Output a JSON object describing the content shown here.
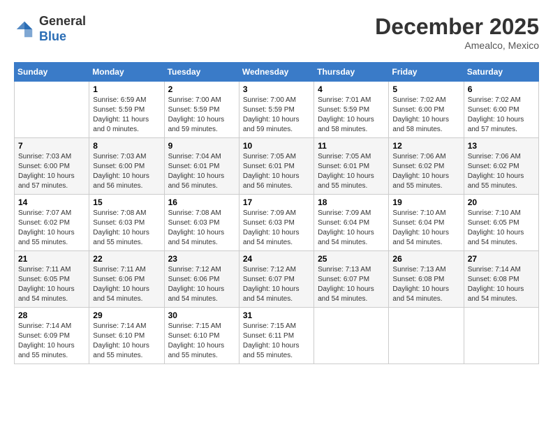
{
  "header": {
    "logo_general": "General",
    "logo_blue": "Blue",
    "month_year": "December 2025",
    "location": "Amealco, Mexico"
  },
  "columns": [
    "Sunday",
    "Monday",
    "Tuesday",
    "Wednesday",
    "Thursday",
    "Friday",
    "Saturday"
  ],
  "weeks": [
    [
      {
        "day": "",
        "info": ""
      },
      {
        "day": "1",
        "info": "Sunrise: 6:59 AM\nSunset: 5:59 PM\nDaylight: 11 hours\nand 0 minutes."
      },
      {
        "day": "2",
        "info": "Sunrise: 7:00 AM\nSunset: 5:59 PM\nDaylight: 10 hours\nand 59 minutes."
      },
      {
        "day": "3",
        "info": "Sunrise: 7:00 AM\nSunset: 5:59 PM\nDaylight: 10 hours\nand 59 minutes."
      },
      {
        "day": "4",
        "info": "Sunrise: 7:01 AM\nSunset: 5:59 PM\nDaylight: 10 hours\nand 58 minutes."
      },
      {
        "day": "5",
        "info": "Sunrise: 7:02 AM\nSunset: 6:00 PM\nDaylight: 10 hours\nand 58 minutes."
      },
      {
        "day": "6",
        "info": "Sunrise: 7:02 AM\nSunset: 6:00 PM\nDaylight: 10 hours\nand 57 minutes."
      }
    ],
    [
      {
        "day": "7",
        "info": "Sunrise: 7:03 AM\nSunset: 6:00 PM\nDaylight: 10 hours\nand 57 minutes."
      },
      {
        "day": "8",
        "info": "Sunrise: 7:03 AM\nSunset: 6:00 PM\nDaylight: 10 hours\nand 56 minutes."
      },
      {
        "day": "9",
        "info": "Sunrise: 7:04 AM\nSunset: 6:01 PM\nDaylight: 10 hours\nand 56 minutes."
      },
      {
        "day": "10",
        "info": "Sunrise: 7:05 AM\nSunset: 6:01 PM\nDaylight: 10 hours\nand 56 minutes."
      },
      {
        "day": "11",
        "info": "Sunrise: 7:05 AM\nSunset: 6:01 PM\nDaylight: 10 hours\nand 55 minutes."
      },
      {
        "day": "12",
        "info": "Sunrise: 7:06 AM\nSunset: 6:02 PM\nDaylight: 10 hours\nand 55 minutes."
      },
      {
        "day": "13",
        "info": "Sunrise: 7:06 AM\nSunset: 6:02 PM\nDaylight: 10 hours\nand 55 minutes."
      }
    ],
    [
      {
        "day": "14",
        "info": "Sunrise: 7:07 AM\nSunset: 6:02 PM\nDaylight: 10 hours\nand 55 minutes."
      },
      {
        "day": "15",
        "info": "Sunrise: 7:08 AM\nSunset: 6:03 PM\nDaylight: 10 hours\nand 55 minutes."
      },
      {
        "day": "16",
        "info": "Sunrise: 7:08 AM\nSunset: 6:03 PM\nDaylight: 10 hours\nand 54 minutes."
      },
      {
        "day": "17",
        "info": "Sunrise: 7:09 AM\nSunset: 6:03 PM\nDaylight: 10 hours\nand 54 minutes."
      },
      {
        "day": "18",
        "info": "Sunrise: 7:09 AM\nSunset: 6:04 PM\nDaylight: 10 hours\nand 54 minutes."
      },
      {
        "day": "19",
        "info": "Sunrise: 7:10 AM\nSunset: 6:04 PM\nDaylight: 10 hours\nand 54 minutes."
      },
      {
        "day": "20",
        "info": "Sunrise: 7:10 AM\nSunset: 6:05 PM\nDaylight: 10 hours\nand 54 minutes."
      }
    ],
    [
      {
        "day": "21",
        "info": "Sunrise: 7:11 AM\nSunset: 6:05 PM\nDaylight: 10 hours\nand 54 minutes."
      },
      {
        "day": "22",
        "info": "Sunrise: 7:11 AM\nSunset: 6:06 PM\nDaylight: 10 hours\nand 54 minutes."
      },
      {
        "day": "23",
        "info": "Sunrise: 7:12 AM\nSunset: 6:06 PM\nDaylight: 10 hours\nand 54 minutes."
      },
      {
        "day": "24",
        "info": "Sunrise: 7:12 AM\nSunset: 6:07 PM\nDaylight: 10 hours\nand 54 minutes."
      },
      {
        "day": "25",
        "info": "Sunrise: 7:13 AM\nSunset: 6:07 PM\nDaylight: 10 hours\nand 54 minutes."
      },
      {
        "day": "26",
        "info": "Sunrise: 7:13 AM\nSunset: 6:08 PM\nDaylight: 10 hours\nand 54 minutes."
      },
      {
        "day": "27",
        "info": "Sunrise: 7:14 AM\nSunset: 6:08 PM\nDaylight: 10 hours\nand 54 minutes."
      }
    ],
    [
      {
        "day": "28",
        "info": "Sunrise: 7:14 AM\nSunset: 6:09 PM\nDaylight: 10 hours\nand 55 minutes."
      },
      {
        "day": "29",
        "info": "Sunrise: 7:14 AM\nSunset: 6:10 PM\nDaylight: 10 hours\nand 55 minutes."
      },
      {
        "day": "30",
        "info": "Sunrise: 7:15 AM\nSunset: 6:10 PM\nDaylight: 10 hours\nand 55 minutes."
      },
      {
        "day": "31",
        "info": "Sunrise: 7:15 AM\nSunset: 6:11 PM\nDaylight: 10 hours\nand 55 minutes."
      },
      {
        "day": "",
        "info": ""
      },
      {
        "day": "",
        "info": ""
      },
      {
        "day": "",
        "info": ""
      }
    ]
  ]
}
